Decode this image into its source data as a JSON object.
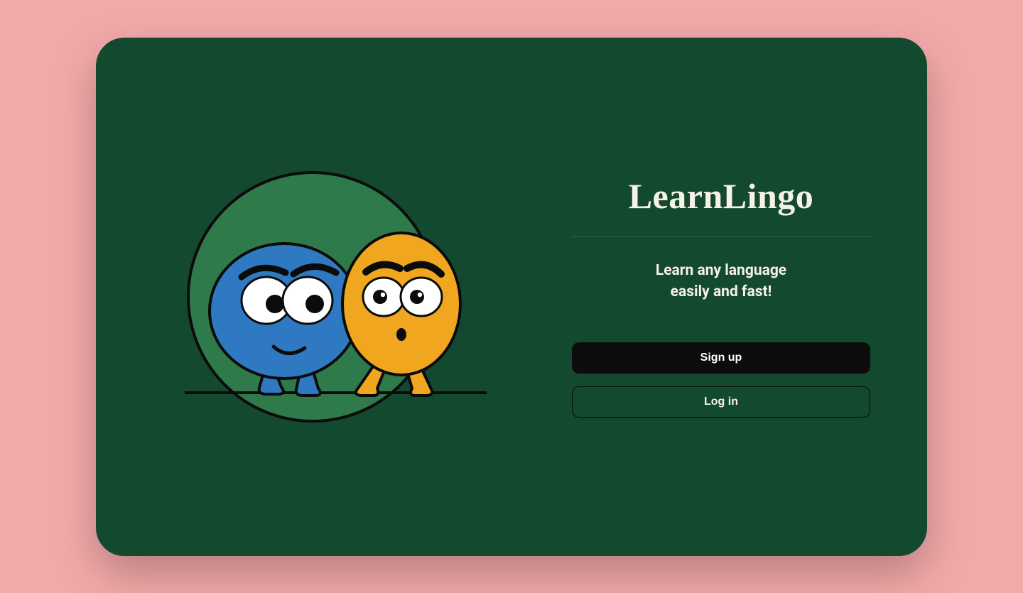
{
  "hero": {
    "title": "LearnLingo",
    "tagline": "Learn any language\neasily and fast!"
  },
  "buttons": {
    "signup_label": "Sign up",
    "login_label": "Log in"
  },
  "colors": {
    "card_bg": "#12492f",
    "page_bg": "#f4a9a9",
    "circle": "#2e7a4b",
    "blue_char": "#2f79c3",
    "orange_char": "#f0a61f",
    "stroke": "#0b0b0b"
  }
}
